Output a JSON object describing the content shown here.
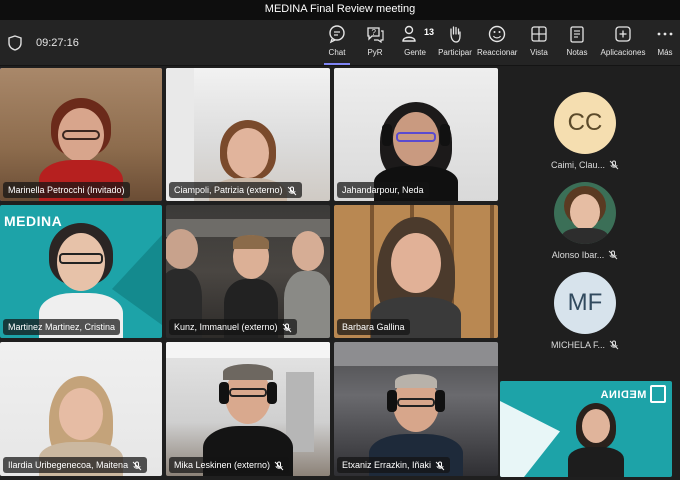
{
  "window": {
    "title": "MEDINA Final Review meeting"
  },
  "toolbar": {
    "timer": "09:27:16",
    "buttons": [
      {
        "label": "Chat",
        "icon": "chat-icon"
      },
      {
        "label": "PyR",
        "icon": "qa-icon"
      },
      {
        "label": "Gente",
        "icon": "people-icon",
        "count": "13"
      },
      {
        "label": "Participar",
        "icon": "raise-hand-icon"
      },
      {
        "label": "Reaccionar",
        "icon": "react-icon"
      },
      {
        "label": "Vista",
        "icon": "view-icon"
      },
      {
        "label": "Notas",
        "icon": "notes-icon"
      },
      {
        "label": "Aplicaciones",
        "icon": "apps-icon"
      },
      {
        "label": "Más",
        "icon": "more-icon"
      }
    ],
    "accent": "#7f85f5"
  },
  "grid": {
    "tiles": [
      {
        "name": "Marinella Petrocchi (Invitado)",
        "muted": false
      },
      {
        "name": "Ciampoli, Patrizia (externo)",
        "muted": true
      },
      {
        "name": "Jahandarpour, Neda",
        "muted": false
      },
      {
        "name": "Martinez Martinez, Cristina",
        "muted": false,
        "logo": "MEDINA"
      },
      {
        "name": "Kunz, Immanuel (externo)",
        "muted": true
      },
      {
        "name": "Barbara Gallina",
        "muted": false
      },
      {
        "name": "Ilardia Uribegenecoa, Maitena",
        "muted": true
      },
      {
        "name": "Mika Leskinen (externo)",
        "muted": true
      },
      {
        "name": "Etxaniz Errazkin, Iñaki",
        "muted": true
      }
    ]
  },
  "sidebar": {
    "people": [
      {
        "initials": "CC",
        "name": "Caimi, Clau...",
        "muted": true
      },
      {
        "initials": "",
        "name": "Alonso Ibar...",
        "muted": true
      },
      {
        "initials": "MF",
        "name": "MICHELA F...",
        "muted": true
      }
    ],
    "self_view": {
      "logo": "MEDINA"
    }
  }
}
